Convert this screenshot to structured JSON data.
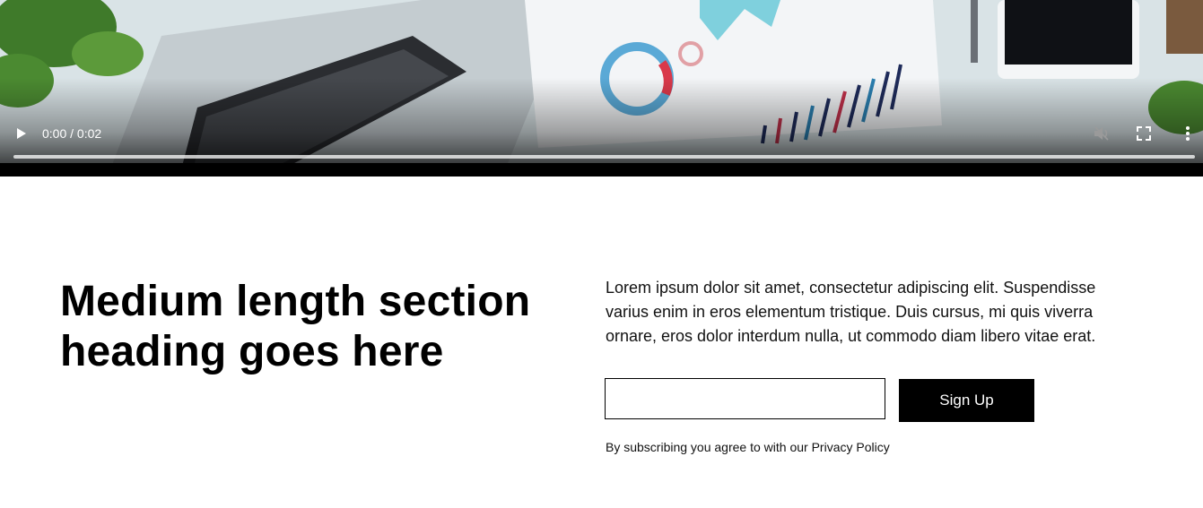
{
  "video": {
    "time_display": "0:00 / 0:02",
    "progress_fraction": 0,
    "play_icon": "play-icon",
    "volume_icon": "volume-muted-icon",
    "fullscreen_icon": "fullscreen-icon",
    "more_icon": "more-vertical-icon"
  },
  "section": {
    "heading": "Medium length section heading goes here",
    "body": "Lorem ipsum dolor sit amet, consectetur adipiscing elit. Suspendisse varius enim in eros elementum tristique. Duis cursus, mi quis viverra ornare, eros dolor interdum nulla, ut commodo diam libero vitae erat.",
    "email_value": "",
    "email_placeholder": "",
    "signup_label": "Sign Up",
    "legal_prefix": "By subscribing you agree to with our ",
    "legal_link": "Privacy Policy"
  },
  "colors": {
    "button_bg": "#000000",
    "button_text": "#ffffff",
    "page_bg": "#ffffff"
  }
}
